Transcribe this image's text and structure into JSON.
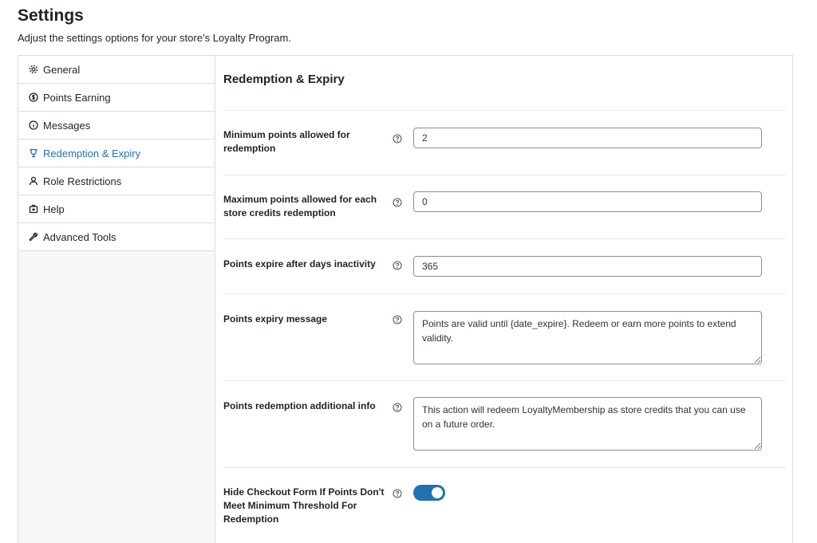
{
  "page": {
    "title": "Settings",
    "subtitle": "Adjust the settings options for your store’s Loyalty Program."
  },
  "sidebar": {
    "items": [
      {
        "label": "General",
        "icon": "gear-icon"
      },
      {
        "label": "Points Earning",
        "icon": "dollar-circle-icon"
      },
      {
        "label": "Messages",
        "icon": "info-circle-icon"
      },
      {
        "label": "Redemption & Expiry",
        "icon": "trophy-icon",
        "active": true
      },
      {
        "label": "Role Restrictions",
        "icon": "user-icon"
      },
      {
        "label": "Help",
        "icon": "lifebuoy-icon"
      },
      {
        "label": "Advanced Tools",
        "icon": "wrench-icon"
      }
    ]
  },
  "main": {
    "section_title": "Redemption & Expiry",
    "fields": {
      "min_points": {
        "label": "Minimum points allowed for redemption",
        "value": "2"
      },
      "max_points": {
        "label": "Maximum points allowed for each store credits redemption",
        "value": "0"
      },
      "expire_days": {
        "label": "Points expire after days inactivity",
        "value": "365"
      },
      "expiry_message": {
        "label": "Points expiry message",
        "value": "Points are valid until {date_expire}. Redeem or earn more points to extend validity."
      },
      "redemption_info": {
        "label": "Points redemption additional info",
        "value": "This action will redeem LoyaltyMembership as store credits that you can use on a future order."
      },
      "hide_checkout": {
        "label": "Hide Checkout Form If Points Don't Meet Minimum Threshold For Redemption",
        "enabled": true
      }
    }
  },
  "colors": {
    "accent": "#2271b1",
    "border": "#dcdcde",
    "sidebar_bg": "#f6f7f7"
  }
}
